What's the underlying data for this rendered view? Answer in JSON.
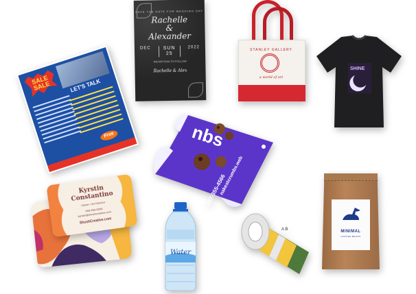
{
  "flyer": {
    "burst_text": "SALE SALE",
    "talk_label": "LET'S TALK",
    "free_badge": "Free"
  },
  "invitation": {
    "top_text": "SAVE THE DATE FOR WEDDING DAY",
    "name_line1": "Rachelle",
    "ampersand": "&",
    "name_line2": "Alexander",
    "month": "DEC",
    "weekday": "SUN",
    "day": "25",
    "year": "2022",
    "venue_text": "RECEPTION TO FOLLOW",
    "signature": "Rachelle & Alex"
  },
  "tote": {
    "brand": "STANLEY GALLERY",
    "tagline": "a world of art"
  },
  "tshirt": {
    "graphic_text": "SHINE"
  },
  "banner": {
    "big_text": "nbs",
    "url_text": "nakestcrumbs.web",
    "phone_text": "207-355-4566"
  },
  "business_card": {
    "name_line1": "Kyrstin",
    "name_line2": "Constantino",
    "title": "Owner / Art Director",
    "contact_line1": "555-555-5555",
    "contact_line2": "kyrstin@shushcreative.com",
    "website": "ShushCreative.com"
  },
  "bottle": {
    "label_text": "Water"
  },
  "sticker_roll": {
    "letters": "A B"
  },
  "pouch": {
    "brand": "MINIMAL",
    "subtitle": "COFFEE BEANS"
  },
  "colors": {
    "tote_red": "#c8222a",
    "flyer_blue": "#1d4fa3",
    "banner_purple": "#5b35c9",
    "pouch_kraft": "#b98457"
  }
}
